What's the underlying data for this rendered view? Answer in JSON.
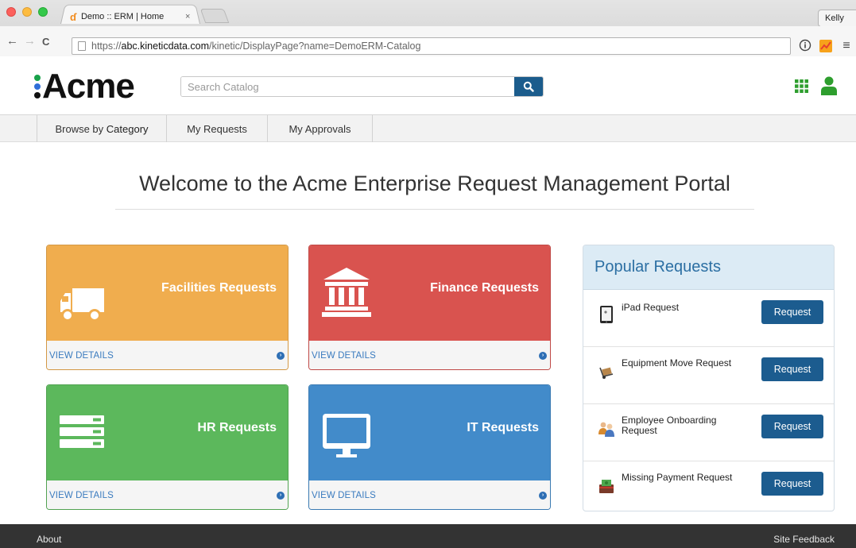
{
  "browser": {
    "tab_title": "Demo :: ERM | Home",
    "tab_close": "×",
    "profile_name": "Kelly",
    "url_scheme": "https://",
    "url_host": "abc.kineticdata.com",
    "url_path": "/kinetic/DisplayPage?name=DemoERM-Catalog",
    "nav_back": "←",
    "nav_forward": "→",
    "nav_reload": "C",
    "menu_glyph": "≡"
  },
  "header": {
    "logo_text": "Acme",
    "logo_dot_colors": [
      "#19a24a",
      "#2f6ed8",
      "#111111"
    ],
    "search_placeholder": "Search Catalog",
    "apps_icon_color": "#2e9e2e",
    "user_icon_color": "#2e9e2e"
  },
  "nav": {
    "browse_prefix": "Browse by ",
    "browse_label": "Category",
    "my_requests": "My Requests",
    "my_approvals": "My Approvals"
  },
  "welcome": {
    "title": "Welcome to the Acme Enterprise Request Management Portal"
  },
  "categories": [
    {
      "title": "Facilities Requests",
      "link": "VIEW DETAILS",
      "color": "#f0ad4e",
      "icon": "truck-icon"
    },
    {
      "title": "Finance Requests",
      "link": "VIEW DETAILS",
      "color": "#d9534f",
      "icon": "bank-icon"
    },
    {
      "title": "HR Requests",
      "link": "VIEW DETAILS",
      "color": "#5cb85c",
      "icon": "server-icon"
    },
    {
      "title": "IT Requests",
      "link": "VIEW DETAILS",
      "color": "#428bca",
      "icon": "monitor-icon"
    }
  ],
  "popular": {
    "title": "Popular Requests",
    "items": [
      {
        "label": "iPad Request",
        "button": "Request",
        "icon": "ipad-icon"
      },
      {
        "label": "Equipment Move Request",
        "button": "Request",
        "icon": "dolly-icon"
      },
      {
        "label": "Employee Onboarding Request",
        "button": "Request",
        "icon": "people-icon"
      },
      {
        "label": "Missing Payment Request",
        "button": "Request",
        "icon": "money-icon"
      }
    ]
  },
  "footer": {
    "about": "About",
    "feedback": "Site Feedback"
  }
}
